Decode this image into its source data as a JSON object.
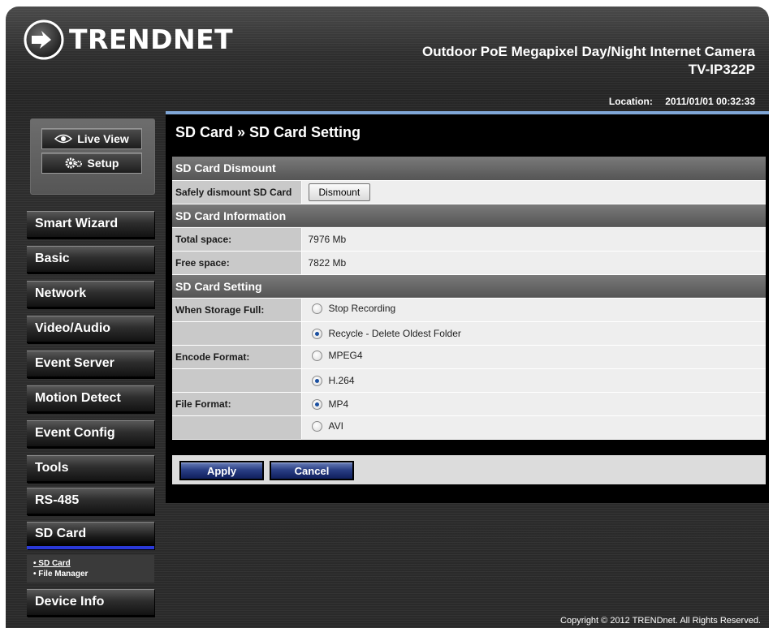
{
  "header": {
    "brand": "TRENDNET",
    "product_title": "Outdoor PoE Megapixel Day/Night Internet Camera",
    "product_model": "TV-IP322P",
    "location_label": "Location:",
    "location_value": "2011/01/01 00:32:33"
  },
  "view_buttons": {
    "live_view": "Live View",
    "setup": "Setup"
  },
  "nav": {
    "items": [
      {
        "label": "Smart Wizard"
      },
      {
        "label": "Basic"
      },
      {
        "label": "Network"
      },
      {
        "label": "Video/Audio"
      },
      {
        "label": "Event Server"
      },
      {
        "label": "Motion Detect"
      },
      {
        "label": "Event Config"
      },
      {
        "label": "Tools"
      },
      {
        "label": "RS-485"
      },
      {
        "label": "SD Card"
      },
      {
        "label": "Device Info"
      }
    ],
    "active": "SD Card",
    "sub_items": [
      "• SD Card",
      "• File Manager"
    ]
  },
  "content": {
    "title": "SD Card » SD Card Setting",
    "sections": {
      "dismount": "SD Card Dismount",
      "information": "SD Card Information",
      "setting": "SD Card Setting"
    },
    "dismount_label": "Safely dismount SD Card",
    "dismount_button": "Dismount",
    "total_label": "Total space:",
    "total_value": "7976 Mb",
    "free_label": "Free space:",
    "free_value": "7822 Mb",
    "storage_full_label": "When Storage Full:",
    "storage_full_options": [
      "Stop Recording",
      "Recycle - Delete Oldest Folder"
    ],
    "storage_full_selected": 1,
    "encode_label": "Encode Format:",
    "encode_options": [
      "MPEG4",
      "H.264"
    ],
    "encode_selected": 1,
    "file_format_label": "File Format:",
    "file_format_options": [
      "MP4",
      "AVI"
    ],
    "file_format_selected": 0,
    "apply": "Apply",
    "cancel": "Cancel"
  },
  "footer": {
    "copyright": "Copyright © 2012 TRENDnet. All Rights Reserved."
  },
  "colors": {
    "content_accent": "#7fa6d6",
    "active_nav_underline": "#2a39d8",
    "action_button": "#2a3f86"
  }
}
